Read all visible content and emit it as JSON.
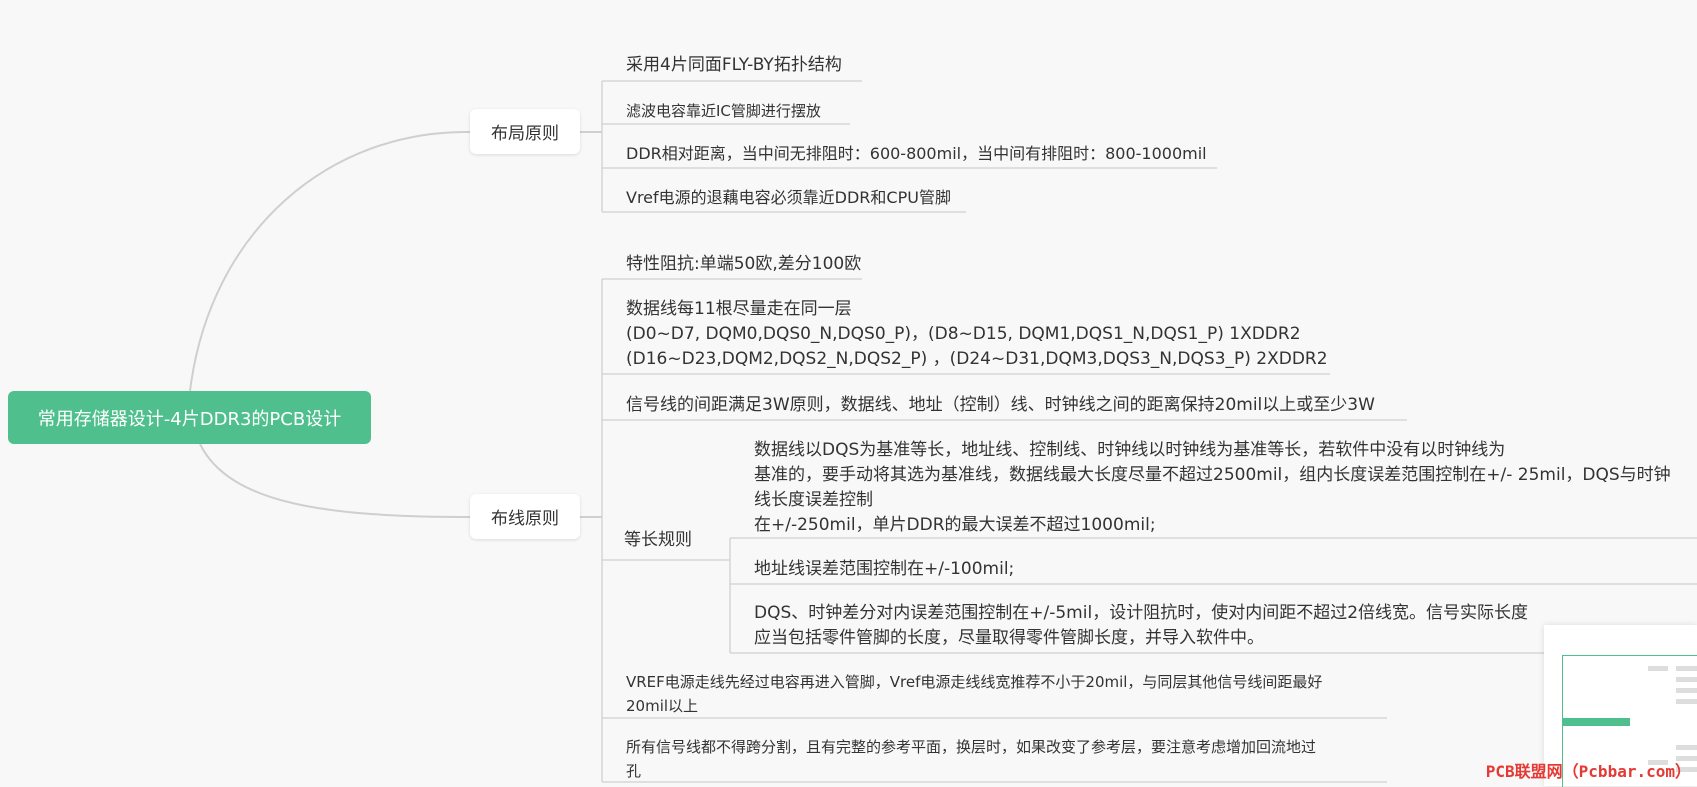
{
  "root": {
    "label": "常用存储器设计-4片DDR3的PCB设计"
  },
  "layout_branch": {
    "label": "布局原则",
    "items": [
      "采用4片同面FLY-BY拓扑结构",
      "滤波电容靠近IC管脚进行摆放",
      "DDR相对距离，当中间无排阻时：600-800mil，当中间有排阻时：800-1000mil",
      "Vref电源的退藕电容必须靠近DDR和CPU管脚"
    ]
  },
  "routing_branch": {
    "label": "布线原则",
    "impedance": "特性阻抗:单端50欧,差分100欧",
    "data_lines": [
      "数据线每11根尽量走在同一层",
      "(D0~D7, DQM0,DQS0_N,DQS0_P)，(D8~D15, DQM1,DQS1_N,DQS1_P) 1XDDR2",
      "(D16~D23,DQM2,DQS2_N,DQS2_P) ，(D24~D31,DQM3,DQS3_N,DQS3_P) 2XDDR2"
    ],
    "spacing": "信号线的间距满足3W原则，数据线、地址（控制）线、时钟线之间的距离保持20mil以上或至少3W",
    "equal_length": {
      "label": "等长规则",
      "rule1": [
        "数据线以DQS为基准等长，地址线、控制线、时钟线以时钟线为基准等长，若软件中没有以时钟线为",
        "基准的，要手动将其选为基准线，数据线最大长度尽量不超过2500mil，组内长度误差范围控制在+/- 25mil，DQS与时钟",
        "线长度误差控制",
        "在+/-250mil，单片DDR的最大误差不超过1000mil;"
      ],
      "rule2": "地址线误差范围控制在+/-100mil;",
      "rule3": [
        "DQS、时钟差分对内误差范围控制在+/-5mil，设计阻抗时，使对内间距不超过2倍线宽。信号实际长度",
        "应当包括零件管脚的长度，尽量取得零件管脚长度，并导入软件中。"
      ]
    },
    "vref": [
      "VREF电源走线先经过电容再进入管脚，Vref电源走线线宽推荐不小于20mil，与同层其他信号线间距最好",
      "20mil以上"
    ],
    "plane": [
      "所有信号线都不得跨分割，且有完整的参考平面，换层时，如果改变了参考层，要注意考虑增加回流地过",
      "孔"
    ]
  },
  "watermark": "PCB联盟网（Pcbbar.com）",
  "colors": {
    "accent": "#4fc08d",
    "line": "#cccccc",
    "watermark": "#e53935"
  }
}
